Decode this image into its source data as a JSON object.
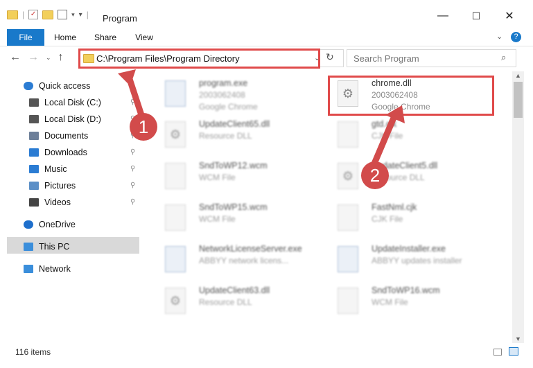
{
  "window": {
    "title": "Program",
    "min_glyph": "—",
    "max_glyph": "☐",
    "close_glyph": "✕"
  },
  "ribbon": {
    "tabs": [
      "File",
      "Home",
      "Share",
      "View"
    ]
  },
  "address": {
    "path": "C:\\Program Files\\Program Directory",
    "search_placeholder": "Search Program"
  },
  "nav": {
    "items": [
      {
        "label": "Quick access",
        "icon": "star-icon",
        "pinned": false
      },
      {
        "label": "Local Disk (C:)",
        "icon": "drive-icon",
        "pinned": true
      },
      {
        "label": "Local Disk (D:)",
        "icon": "drive-icon",
        "pinned": true
      },
      {
        "label": "Documents",
        "icon": "documents-icon",
        "pinned": true
      },
      {
        "label": "Downloads",
        "icon": "download-icon",
        "pinned": true
      },
      {
        "label": "Music",
        "icon": "music-icon",
        "pinned": true
      },
      {
        "label": "Pictures",
        "icon": "pictures-icon",
        "pinned": true
      },
      {
        "label": "Videos",
        "icon": "videos-icon",
        "pinned": true
      },
      {
        "label": "OneDrive",
        "icon": "cloud-icon",
        "pinned": false
      },
      {
        "label": "This PC",
        "icon": "computer-icon",
        "pinned": false
      },
      {
        "label": "Network",
        "icon": "network-icon",
        "pinned": false
      }
    ]
  },
  "files": [
    {
      "name": "program.exe",
      "lines": [
        "2003062408",
        "Google Chrome"
      ]
    },
    {
      "name": "chrome.dll",
      "lines": [
        "2003062408",
        "Google Chrome"
      ]
    },
    {
      "name": "UpdateClient65.dll",
      "lines": [
        "Resource DLL"
      ]
    },
    {
      "name": "gtd.cjk",
      "lines": [
        "CJK File"
      ]
    },
    {
      "name": "SndToWP12.wcm",
      "lines": [
        "WCM File"
      ]
    },
    {
      "name": "UpdateClient5.dll",
      "lines": [
        "Resource DLL"
      ]
    },
    {
      "name": "SndToWP15.wcm",
      "lines": [
        "WCM File"
      ]
    },
    {
      "name": "FastNml.cjk",
      "lines": [
        "CJK File"
      ]
    },
    {
      "name": "NetworkLicenseServer.exe",
      "lines": [
        "ABBYY network licens..."
      ]
    },
    {
      "name": "UpdateInstaller.exe",
      "lines": [
        "ABBYY updates installer"
      ]
    },
    {
      "name": "UpdateClient63.dll",
      "lines": [
        "Resource DLL"
      ]
    },
    {
      "name": "SndToWP16.wcm",
      "lines": [
        "WCM File"
      ]
    }
  ],
  "markers": [
    "1",
    "2"
  ],
  "status": {
    "count": "116 items"
  },
  "colors": {
    "accent": "#1979ca",
    "highlight": "#e04a4a",
    "marker": "#d24b4b"
  }
}
